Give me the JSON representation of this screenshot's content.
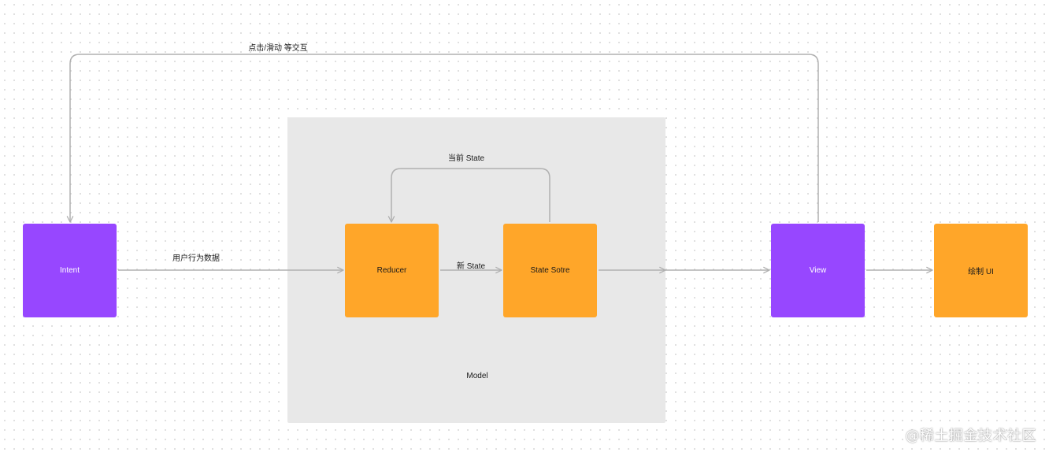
{
  "colors": {
    "purple": "#9747ff",
    "orange": "#ffa629",
    "model_bg": "#e8e8e8",
    "connector": "#b0b0b0"
  },
  "nodes": {
    "intent": "Intent",
    "reducer": "Reducer",
    "state_store": "State Sotre",
    "view": "View",
    "draw_ui": "绘制 UI"
  },
  "model": {
    "label": "Model"
  },
  "edges": {
    "user_action": "用户行为数据",
    "new_state": "新 State",
    "current_state": "当前  State",
    "interaction": "点击/滑动 等交互"
  },
  "watermark": "@稀土掘金技术社区"
}
